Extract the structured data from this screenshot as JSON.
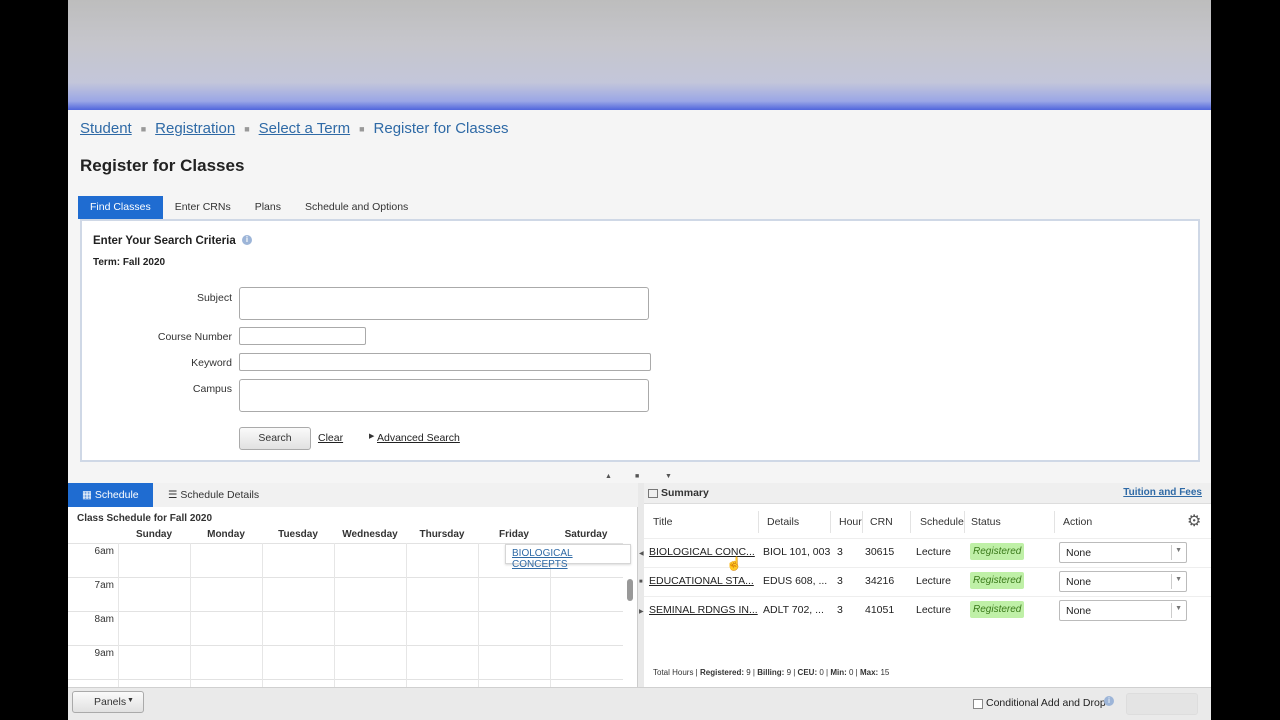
{
  "breadcrumb": {
    "items": [
      "Student",
      "Registration",
      "Select a Term"
    ],
    "current": "Register for Classes"
  },
  "page": {
    "title": "Register for Classes"
  },
  "tabs": [
    "Find Classes",
    "Enter CRNs",
    "Plans",
    "Schedule and Options"
  ],
  "search": {
    "heading": "Enter Your Search Criteria",
    "info_icon": "i",
    "term": "Term: Fall 2020",
    "labels": {
      "subject": "Subject",
      "course_number": "Course Number",
      "keyword": "Keyword",
      "campus": "Campus"
    },
    "values": {
      "subject": "",
      "course_number": "",
      "keyword": "",
      "campus": ""
    },
    "search_label": "Search",
    "clear_label": "Clear",
    "advanced_label": "Advanced Search"
  },
  "schedule": {
    "tab_schedule": "Schedule",
    "tab_details": "Schedule Details",
    "title": "Class Schedule for Fall 2020",
    "days": [
      "Sunday",
      "Monday",
      "Tuesday",
      "Wednesday",
      "Thursday",
      "Friday",
      "Saturday"
    ],
    "times": [
      "6am",
      "7am",
      "8am",
      "9am"
    ],
    "event": "BIOLOGICAL CONCEPTS"
  },
  "summary": {
    "title": "Summary",
    "tuition_link": "Tuition and Fees",
    "columns": [
      "Title",
      "Details",
      "Hour",
      "CRN",
      "Schedule",
      "Status",
      "Action"
    ],
    "rows": [
      {
        "title": "BIOLOGICAL CONC...",
        "details": "BIOL 101, 003",
        "hours": "3",
        "crn": "30615",
        "schedule": "Lecture",
        "status": "Registered",
        "action": "None"
      },
      {
        "title": "EDUCATIONAL STA...",
        "details": "EDUS 608, ...",
        "hours": "3",
        "crn": "34216",
        "schedule": "Lecture",
        "status": "Registered",
        "action": "None"
      },
      {
        "title": "SEMINAL RDNGS IN...",
        "details": "ADLT 702, ...",
        "hours": "3",
        "crn": "41051",
        "schedule": "Lecture",
        "status": "Registered",
        "action": "None"
      }
    ],
    "totals": {
      "label": "Total Hours | ",
      "registered_label": "Registered:",
      "registered": "9",
      "billing_label": "Billing:",
      "billing": "9",
      "ceu_label": "CEU:",
      "ceu": "0",
      "min_label": "Min:",
      "min": "0",
      "max_label": "Max:",
      "max": "15"
    }
  },
  "footer": {
    "panels_label": "Panels",
    "conditional_label": "Conditional Add and Drop",
    "info_icon": "i"
  },
  "colors": {
    "accent": "#1f6cd1",
    "link": "#2f6aa6",
    "registered_bg": "#bff0a7"
  }
}
